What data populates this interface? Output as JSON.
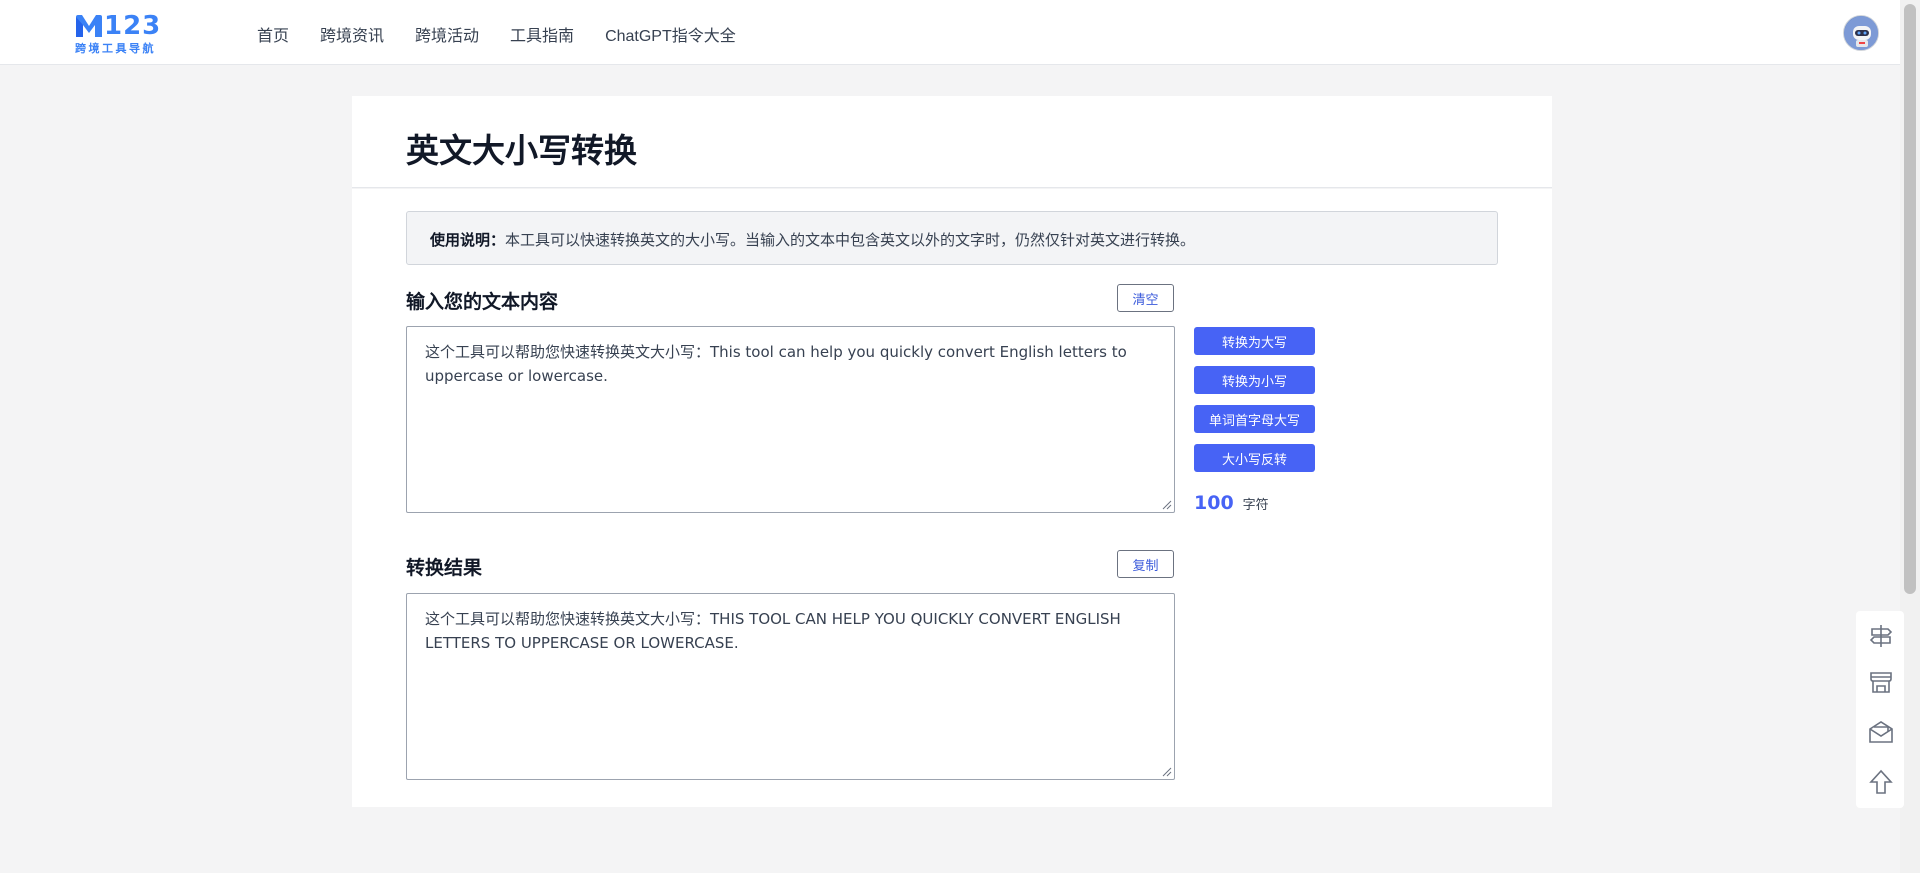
{
  "header": {
    "logo_text": "123",
    "logo_sub": "跨境工具导航",
    "nav": [
      "首页",
      "跨境资讯",
      "跨境活动",
      "工具指南",
      "ChatGPT指令大全"
    ]
  },
  "page": {
    "title": "英文大小写转换",
    "notice_label": "使用说明：",
    "notice_text": "本工具可以快速转换英文的大小写。当输入的文本中包含英文以外的文字时，仍然仅针对英文进行转换。"
  },
  "input": {
    "title": "输入您的文本内容",
    "clear_label": "清空",
    "value": "这个工具可以帮助您快速转换英文大小写：This tool can help you quickly convert English letters to uppercase or lowercase."
  },
  "output": {
    "title": "转换结果",
    "copy_label": "复制",
    "value": "这个工具可以帮助您快速转换英文大小写：THIS TOOL CAN HELP YOU QUICKLY CONVERT ENGLISH LETTERS TO UPPERCASE OR LOWERCASE."
  },
  "actions": {
    "upper": "转换为大写",
    "lower": "转换为小写",
    "title_case": "单词首字母大写",
    "invert": "大小写反转"
  },
  "counter": {
    "count": "100",
    "unit": "字符"
  },
  "colors": {
    "accent": "#4763f5",
    "logo": "#3b82f6",
    "background": "#f4f4f5"
  },
  "side_icons": [
    "signpost-icon",
    "store-icon",
    "mail-open-icon",
    "arrow-up-icon"
  ]
}
